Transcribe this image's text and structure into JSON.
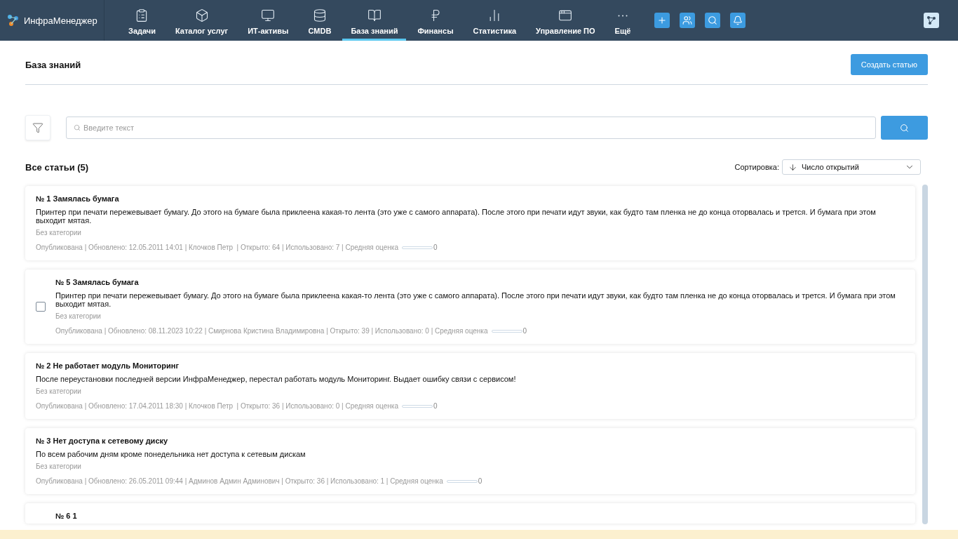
{
  "app": {
    "name": "ИнфраМенеджер"
  },
  "nav": [
    {
      "label": "Задачи",
      "selected": false
    },
    {
      "label": "Каталог услуг",
      "selected": false
    },
    {
      "label": "ИТ-активы",
      "selected": false
    },
    {
      "label": "CMDB",
      "selected": false
    },
    {
      "label": "База знаний",
      "selected": true
    },
    {
      "label": "Финансы",
      "selected": false
    },
    {
      "label": "Статистика",
      "selected": false
    },
    {
      "label": "Управление ПО",
      "selected": false
    },
    {
      "label": "Ещё",
      "selected": false
    }
  ],
  "page": {
    "title": "База знаний",
    "create_button": "Создать статью"
  },
  "search": {
    "placeholder": "Введите текст"
  },
  "list": {
    "heading": "Все статьи (5)",
    "sort_label": "Сортировка:",
    "sort_value": "Число открытий"
  },
  "articles": [
    {
      "title": "№ 1 Замялась бумага",
      "body": "Принтер при печати пережевывает бумагу. До этого на бумаге была приклеена какая-то лента (это уже с самого аппарата). После этого при печати идут звуки, как будто там пленка не до конца оторвалась и трется. И бумага при этом выходит мятая.",
      "category": "Без категории",
      "meta": "Опубликована | Обновлено: 12.05.2011 14:01 | Клочков Петр  | Открыто: 64 | Использовано: 7 | Средняя оценка",
      "level": 0,
      "rating": "0",
      "selectable": false
    },
    {
      "title": "№ 5 Замялась бумага",
      "body": "Принтер при печати пережевывает бумагу. До этого на бумаге была приклеена какая-то лента (это уже с самого аппарата). После этого при печати идут звуки, как будто там пленка не до конца оторвалась и трется. И бумага при этом выходит мятая.",
      "category": "Без категории",
      "meta": "Опубликована | Обновлено: 08.11.2023 10:22 | Смирнова Кристина Владимировна | Открыто: 39 | Использовано: 0 | Средняя оценка",
      "level": 0,
      "rating": "0",
      "selectable": true,
      "checked": false
    },
    {
      "title": "№ 2 Не работает модуль Мониторинг",
      "body": "После переустановки последней версии ИнфраМенеджер, перестал работать модуль Мониторинг. Выдает ошибку связи с сервисом!",
      "category": "Без категории",
      "meta": "Опубликована | Обновлено: 17.04.2011 18:30 | Клочков Петр  | Открыто: 36 | Использовано: 0 | Средняя оценка",
      "level": 0,
      "rating": "0",
      "selectable": false
    },
    {
      "title": "№ 3 Нет доступа к сетевому диску",
      "body": "По всем рабочим дням кроме понедельника нет доступа к сетевым дискам",
      "category": "Без категории",
      "meta": "Опубликована | Обновлено: 26.05.2011 09:44 | Админов Админ Админович | Открыто: 36 | Использовано: 1 | Средняя оценка",
      "level": 0,
      "rating": "0",
      "selectable": false
    },
    {
      "title": "№ 6 1",
      "selectable": true
    }
  ]
}
